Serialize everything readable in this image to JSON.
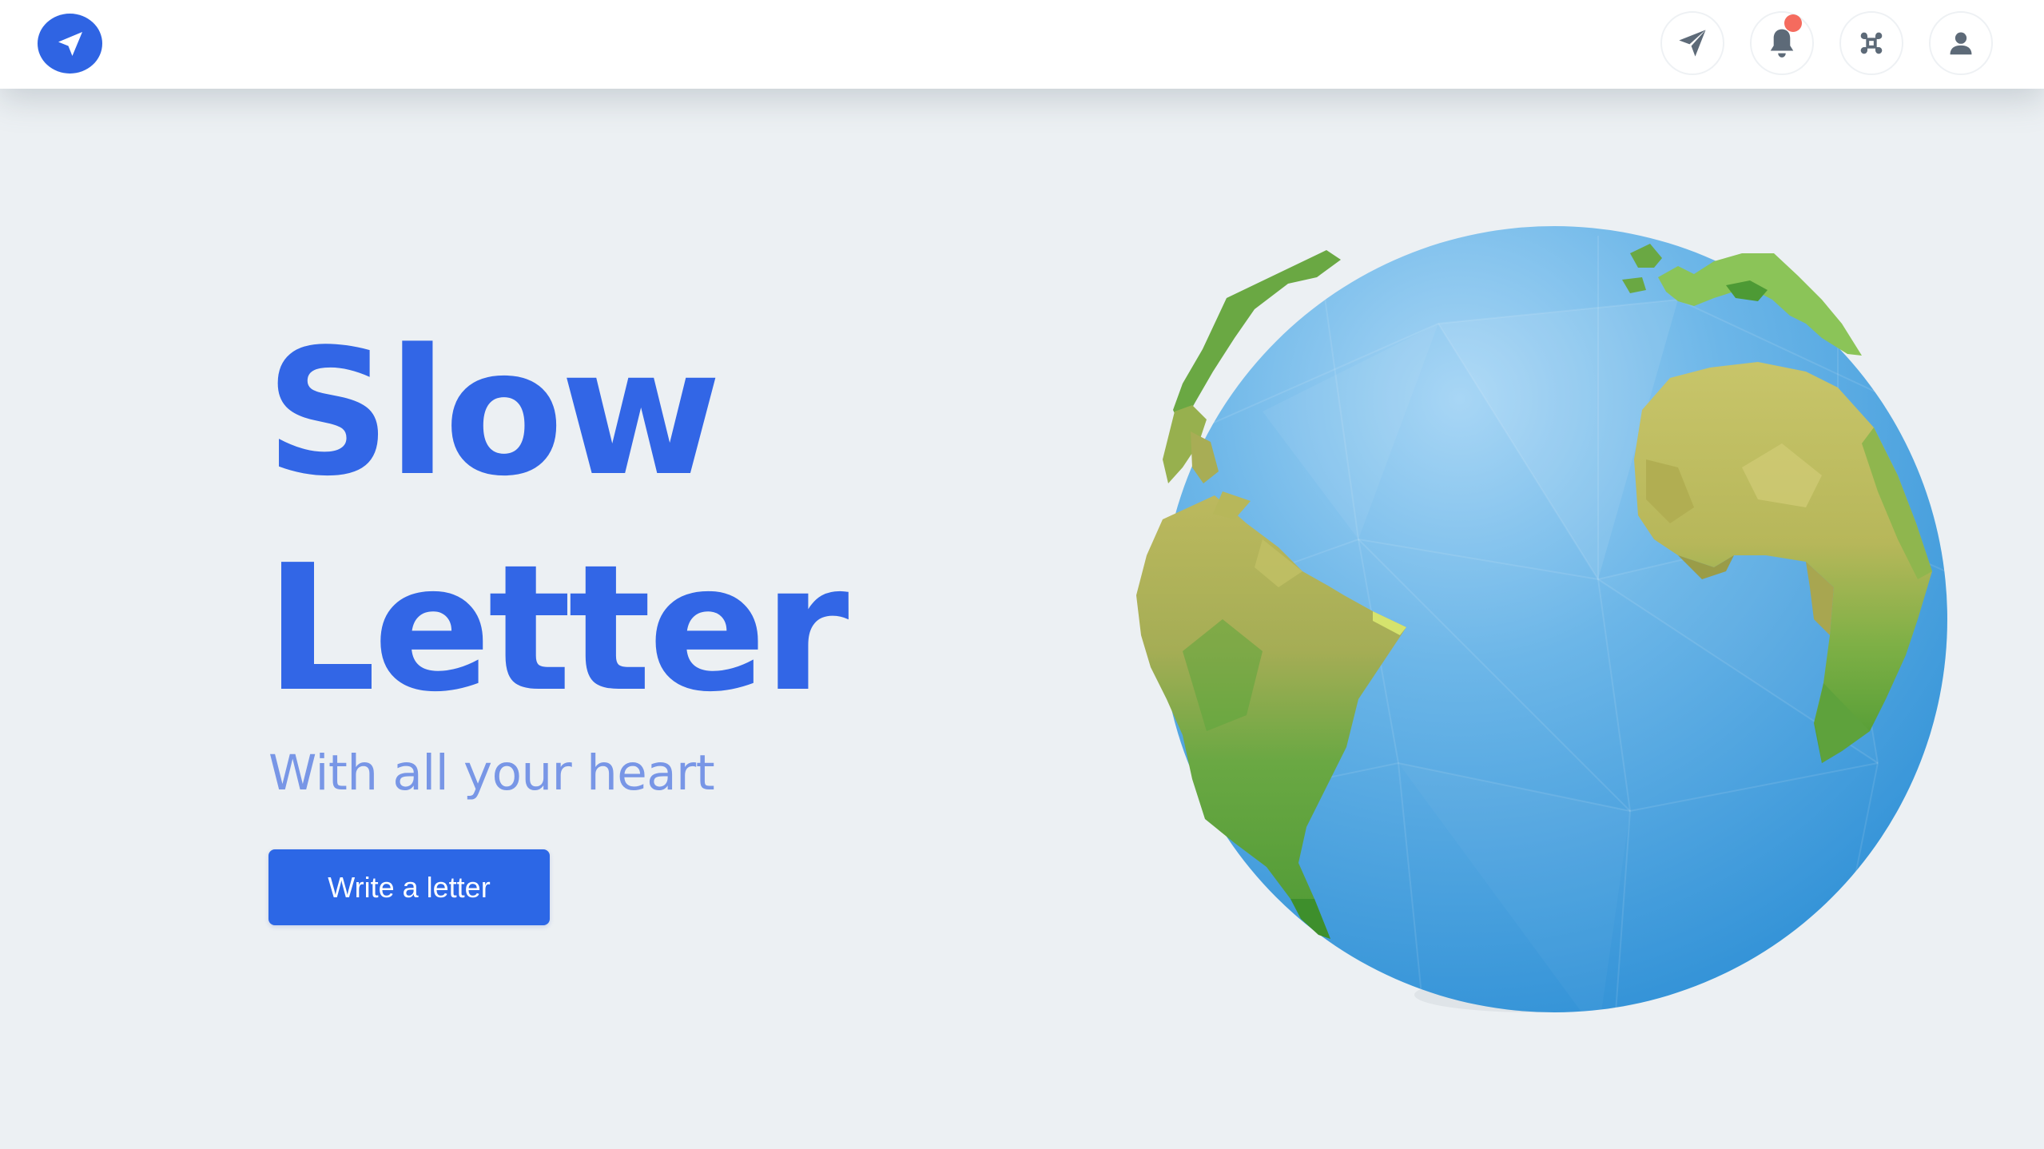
{
  "header": {
    "logo_icon": "paper-plane-icon",
    "nav": [
      {
        "name": "send-letter",
        "icon": "paper-plane-icon"
      },
      {
        "name": "notifications",
        "icon": "bell-icon",
        "has_unread": true
      },
      {
        "name": "command",
        "icon": "command-icon"
      },
      {
        "name": "profile",
        "icon": "user-icon"
      }
    ]
  },
  "hero": {
    "title_line1": "Slow",
    "title_line2": "Letter",
    "subtitle": "With all your heart",
    "cta_label": "Write a letter"
  },
  "colors": {
    "brand": "#2f64e3",
    "title": "#3266e6",
    "subtitle": "#7896e6",
    "background": "#ecf0f3",
    "notification": "#f56b5e",
    "icon_gray": "#5d6a78"
  }
}
